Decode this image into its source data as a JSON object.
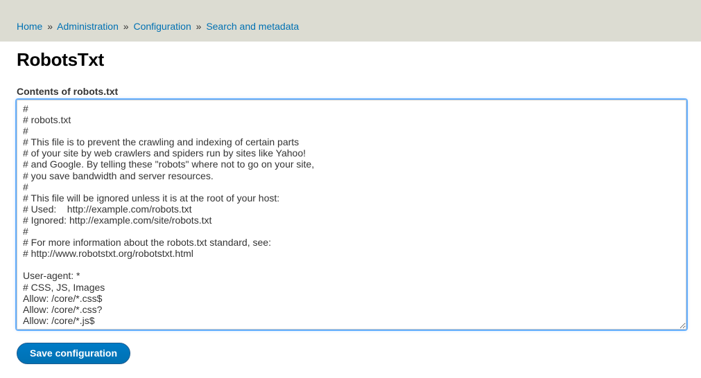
{
  "breadcrumb": {
    "items": [
      {
        "label": "Home"
      },
      {
        "label": "Administration"
      },
      {
        "label": "Configuration"
      },
      {
        "label": "Search and metadata"
      }
    ],
    "separator": "»"
  },
  "page": {
    "title": "RobotsTxt"
  },
  "form": {
    "label": "Contents of robots.txt",
    "textarea_value": "#\n# robots.txt\n#\n# This file is to prevent the crawling and indexing of certain parts\n# of your site by web crawlers and spiders run by sites like Yahoo!\n# and Google. By telling these \"robots\" where not to go on your site,\n# you save bandwidth and server resources.\n#\n# This file will be ignored unless it is at the root of your host:\n# Used:    http://example.com/robots.txt\n# Ignored: http://example.com/site/robots.txt\n#\n# For more information about the robots.txt standard, see:\n# http://www.robotstxt.org/robotstxt.html\n\nUser-agent: *\n# CSS, JS, Images\nAllow: /core/*.css$\nAllow: /core/*.css?\nAllow: /core/*.js$\n",
    "save_label": "Save configuration"
  }
}
